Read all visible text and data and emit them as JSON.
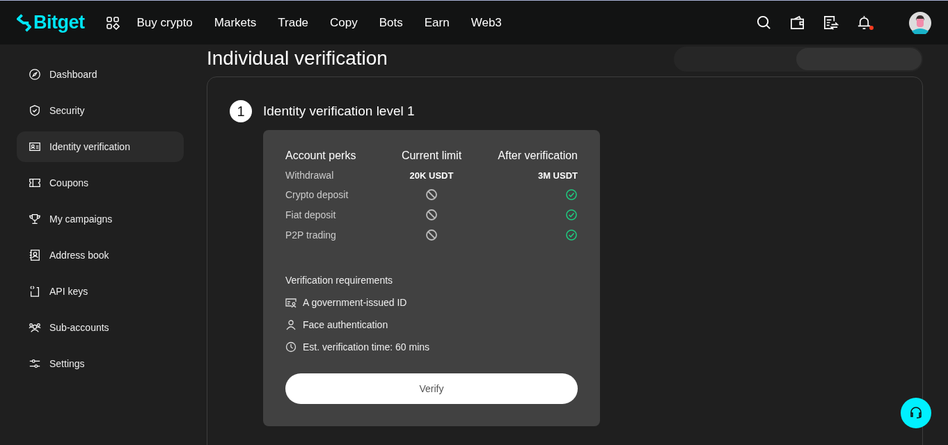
{
  "header": {
    "logo": "Bitget",
    "nav": [
      "Buy crypto",
      "Markets",
      "Trade",
      "Copy",
      "Bots",
      "Earn",
      "Web3"
    ],
    "notification_dot": true
  },
  "sidebar": {
    "items": [
      {
        "label": "Dashboard",
        "selected": false
      },
      {
        "label": "Security",
        "selected": false
      },
      {
        "label": "Identity verification",
        "selected": true
      },
      {
        "label": "Coupons",
        "selected": false
      },
      {
        "label": "My campaigns",
        "selected": false
      },
      {
        "label": "Address book",
        "selected": false
      },
      {
        "label": "API keys",
        "selected": false
      },
      {
        "label": "Sub-accounts",
        "selected": false
      },
      {
        "label": "Settings",
        "selected": false
      }
    ]
  },
  "page_title": "Individual verification",
  "step": {
    "number": "1",
    "title": "Identity verification level 1",
    "perks": {
      "columns": [
        "Account perks",
        "Current limit",
        "After verification"
      ],
      "rows": [
        {
          "label": "Withdrawal",
          "current": {
            "kind": "text",
            "text": "20K USDT"
          },
          "after": {
            "kind": "text",
            "text": "3M USDT"
          }
        },
        {
          "label": "Crypto deposit",
          "current": {
            "kind": "blocked"
          },
          "after": {
            "kind": "check"
          }
        },
        {
          "label": "Fiat deposit",
          "current": {
            "kind": "blocked"
          },
          "after": {
            "kind": "check"
          }
        },
        {
          "label": "P2P trading",
          "current": {
            "kind": "blocked"
          },
          "after": {
            "kind": "check"
          }
        }
      ]
    },
    "requirements_title": "Verification requirements",
    "requirements": [
      {
        "kind": "id",
        "text": "A government-issued ID"
      },
      {
        "kind": "person",
        "text": "Face authentication"
      },
      {
        "kind": "clock",
        "text": "Est. verification time: 60 mins"
      }
    ],
    "button": "Verify"
  }
}
